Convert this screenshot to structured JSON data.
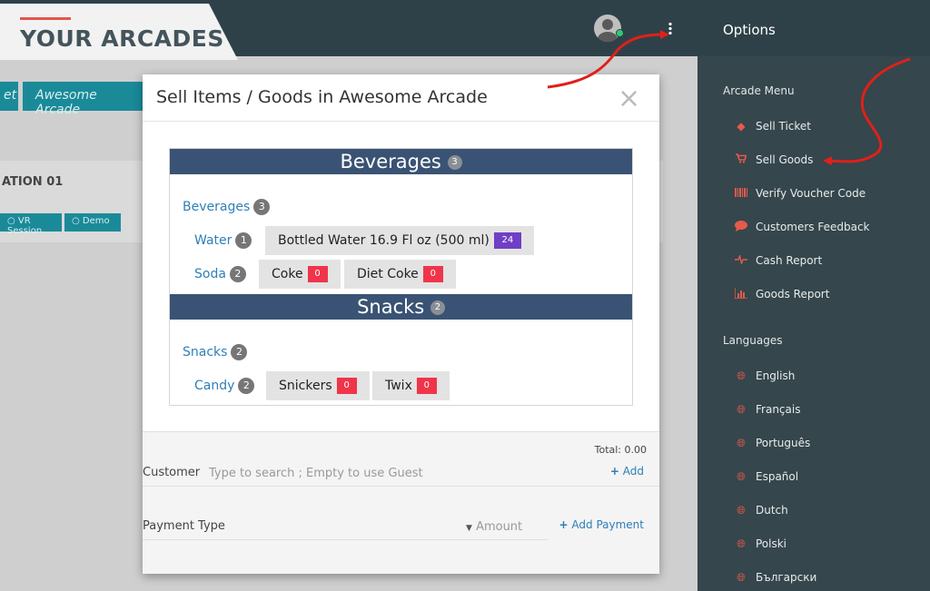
{
  "header": {
    "brand": "YOUR ARCADES",
    "options_title": "Options"
  },
  "background_page": {
    "tabs": [
      "et",
      "Awesome Arcade"
    ],
    "station_label": "ATION 01",
    "pills": [
      "VR Session",
      "Demo"
    ]
  },
  "sidebar": {
    "arcade_menu_title": "Arcade Menu",
    "arcade_menu": [
      {
        "label": "Sell Ticket",
        "icon": "ticket-icon"
      },
      {
        "label": "Sell Goods",
        "icon": "cart-icon"
      },
      {
        "label": "Verify Voucher Code",
        "icon": "barcode-icon"
      },
      {
        "label": "Customers Feedback",
        "icon": "speech-bubble-icon"
      },
      {
        "label": "Cash Report",
        "icon": "pulse-icon"
      },
      {
        "label": "Goods Report",
        "icon": "bar-chart-icon"
      }
    ],
    "languages_title": "Languages",
    "languages": [
      {
        "label": "English",
        "icon": "globe-icon"
      },
      {
        "label": "Français",
        "icon": "globe-icon"
      },
      {
        "label": "Português",
        "icon": "globe-icon"
      },
      {
        "label": "Español",
        "icon": "globe-icon"
      },
      {
        "label": "Dutch",
        "icon": "globe-icon"
      },
      {
        "label": "Polski",
        "icon": "globe-icon"
      },
      {
        "label": "Български",
        "icon": "globe-icon"
      }
    ]
  },
  "modal": {
    "title": "Sell Items / Goods in Awesome Arcade",
    "close": "×",
    "categories": [
      {
        "name": "Beverages",
        "count": "3",
        "sub_name": "Beverages",
        "sub_count": "3",
        "groups": [
          {
            "name": "Water",
            "count": "1",
            "items": [
              {
                "label": "Bottled Water 16.9 Fl oz (500 ml)",
                "qty": "24"
              }
            ]
          },
          {
            "name": "Soda",
            "count": "2",
            "items": [
              {
                "label": "Coke",
                "qty": "0"
              },
              {
                "label": "Diet Coke",
                "qty": "0"
              }
            ]
          }
        ]
      },
      {
        "name": "Snacks",
        "count": "2",
        "sub_name": "Snacks",
        "sub_count": "2",
        "groups": [
          {
            "name": "Candy",
            "count": "2",
            "items": [
              {
                "label": "Snickers",
                "qty": "0"
              },
              {
                "label": "Twix",
                "qty": "0"
              }
            ]
          }
        ]
      }
    ],
    "total_label": "Total: 0.00",
    "customer_label": "Customer",
    "customer_placeholder": "Type to search ; Empty to use Guest",
    "add_label": "Add",
    "payment_type_label": "Payment Type",
    "amount_label": "Amount",
    "add_payment_label": "Add Payment"
  },
  "colors": {
    "header_bg": "#2f4148",
    "sidebar_bg": "#35464c",
    "accent_red": "#e65a4a",
    "category_header": "#3a5374",
    "teal": "#1a8a99",
    "stock_badge": "#6f3fc6",
    "zero_badge": "#f0344a"
  }
}
